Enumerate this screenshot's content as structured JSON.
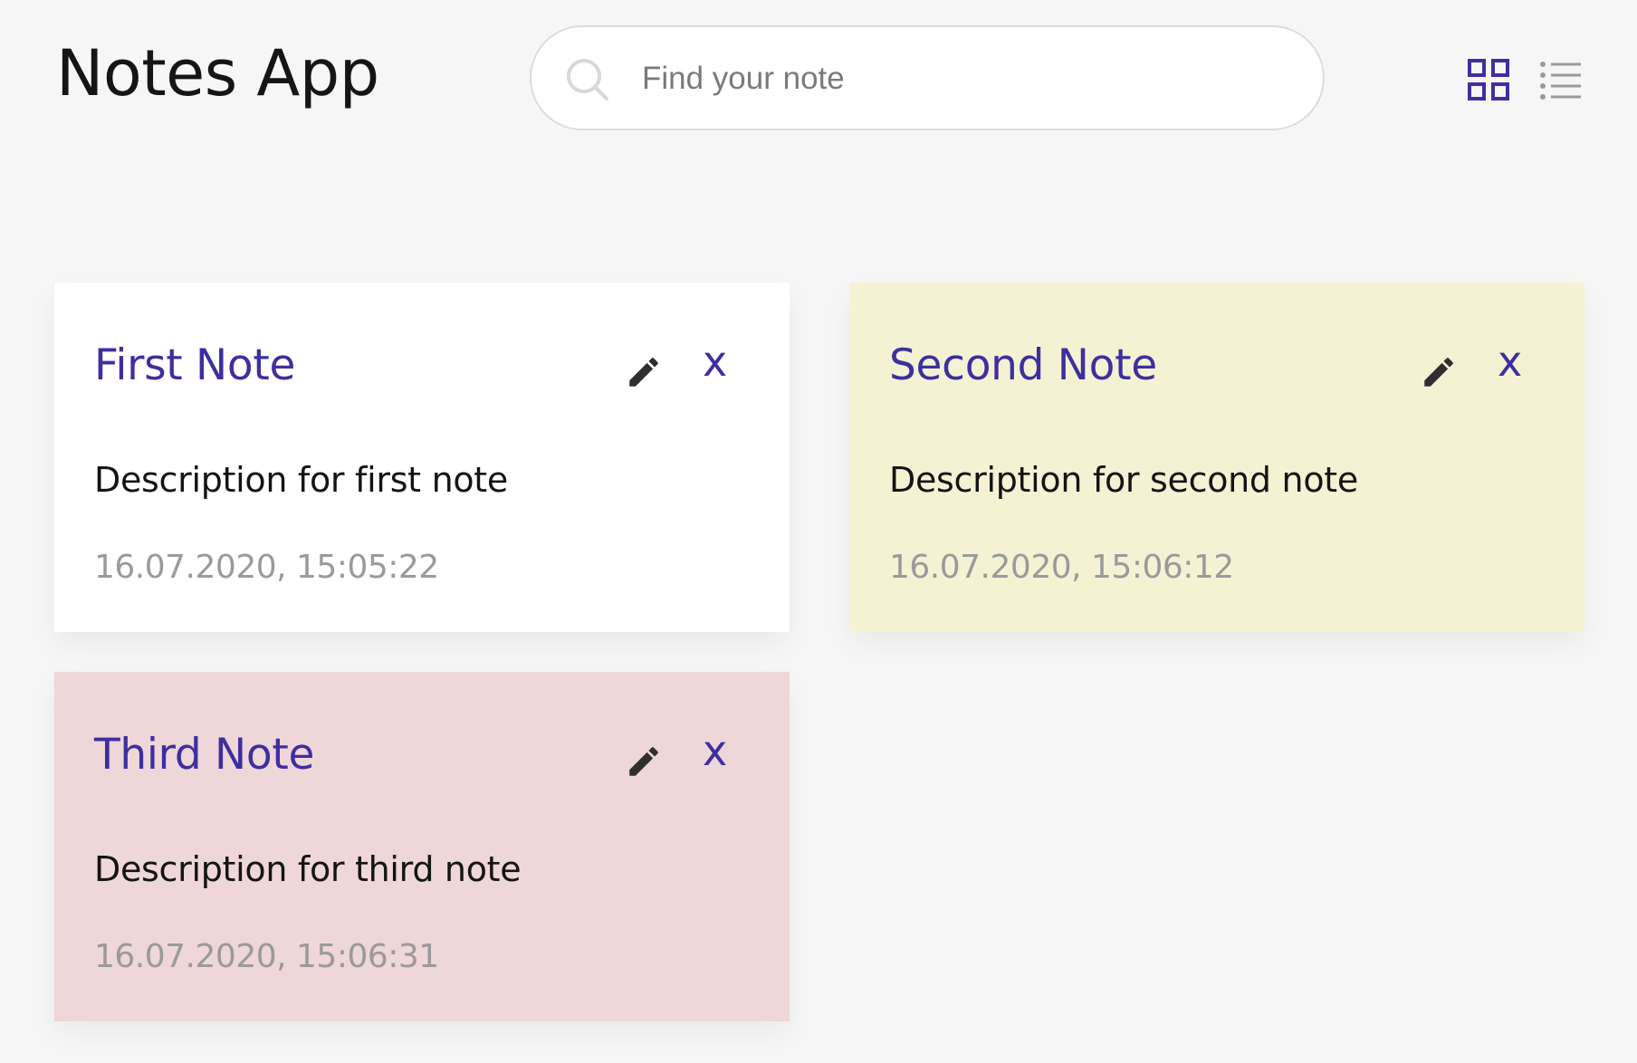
{
  "app": {
    "title": "Notes App"
  },
  "search": {
    "placeholder": "Find your note",
    "value": ""
  },
  "toolbar": {
    "grid_view_icon": "grid-icon",
    "list_view_icon": "list-icon",
    "active_view": "grid",
    "active_color": "#3d2fa0",
    "inactive_color": "#9a9a9a"
  },
  "notes": [
    {
      "title": "First Note",
      "description": "Description for first note",
      "date": "16.07.2020, 15:05:22",
      "color": "#ffffff",
      "delete_label": "x"
    },
    {
      "title": "Second Note",
      "description": "Description for second note",
      "date": "16.07.2020, 15:06:12",
      "color": "#f5f2d4",
      "delete_label": "x"
    },
    {
      "title": "Third Note",
      "description": "Description for third note",
      "date": "16.07.2020, 15:06:31",
      "color": "#efd6d8",
      "delete_label": "x"
    }
  ],
  "colors": {
    "accent": "#3d2fa0",
    "background": "#f6f6f6"
  }
}
